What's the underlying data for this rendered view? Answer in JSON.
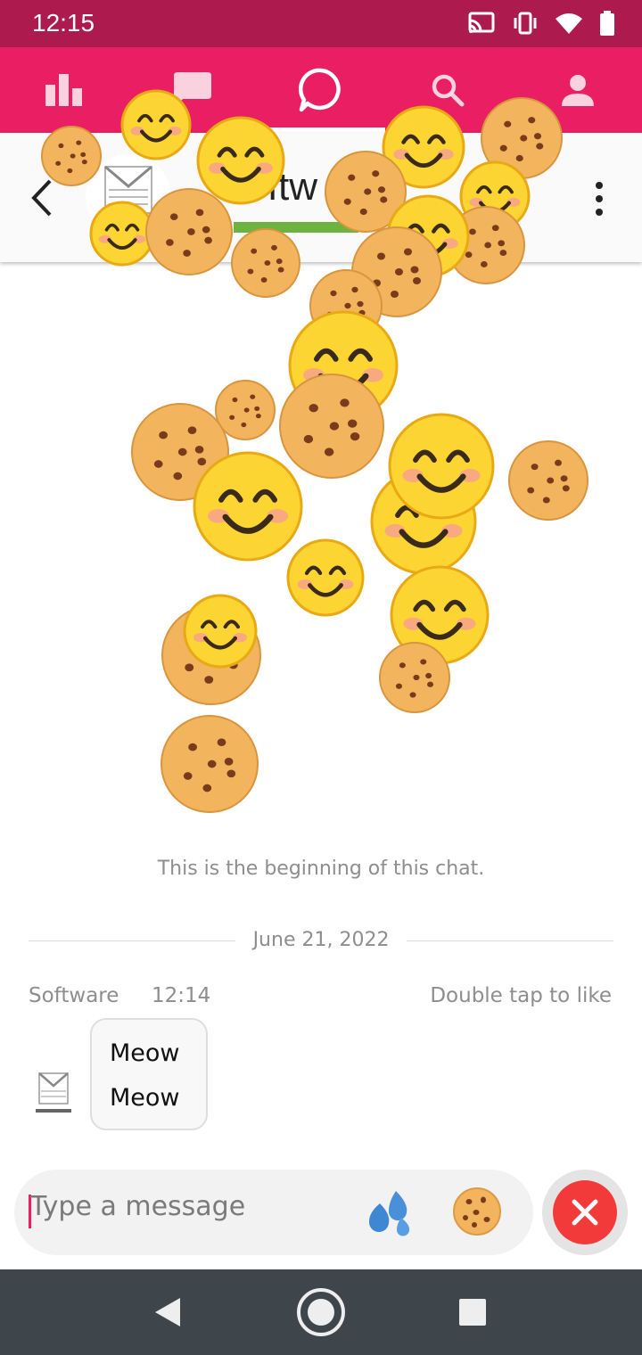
{
  "status_bar": {
    "time": "12:15",
    "icons": [
      "cast-icon",
      "vibrate-icon",
      "wifi-icon",
      "battery-icon"
    ]
  },
  "tabs": [
    {
      "name": "stats",
      "icon": "bar-chart-icon"
    },
    {
      "name": "messages",
      "icon": "chat-bubble-icon"
    },
    {
      "name": "chat",
      "icon": "chat-circle-icon",
      "active": true
    },
    {
      "name": "search",
      "icon": "search-icon"
    },
    {
      "name": "profile",
      "icon": "person-icon"
    }
  ],
  "header": {
    "name": "Softw",
    "status_color": "#6db33f"
  },
  "chat": {
    "beginning_text": "This is the beginning of this chat.",
    "date": "June 21, 2022",
    "message": {
      "sender": "Software",
      "time": "12:14",
      "hint": "Double tap to like",
      "lines": [
        "Meow",
        "Meow"
      ]
    }
  },
  "composer": {
    "placeholder": "Type a message"
  },
  "colors": {
    "accent": "#e91e63",
    "status_bar": "#ad1a4d",
    "close": "#f23a3a",
    "nav_bar": "#3f464b"
  },
  "effects": {
    "emoji": [
      "cookie",
      "smiling-face"
    ]
  }
}
